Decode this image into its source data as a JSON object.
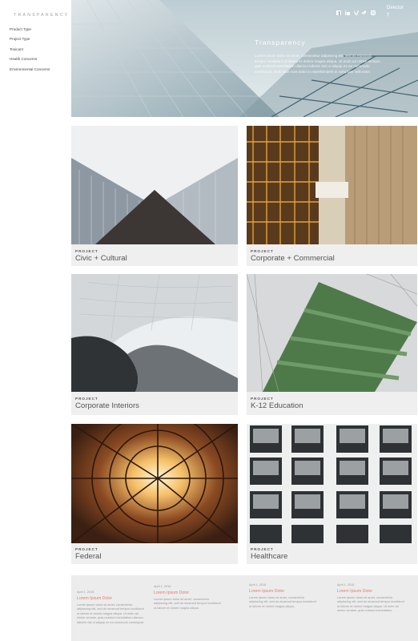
{
  "sidebar": {
    "brand": "TRANSPARENCY",
    "items": [
      "Product Type",
      "Project Type",
      "Toxicant",
      "Health Concerns",
      "Environmental Concerns"
    ]
  },
  "hero": {
    "title": "Transparency",
    "paragraph": "Lorem ipsum dolor sit amet, consectetur adipiscing elit, sed do eiusmod tempor incididunt ut labore et dolore magna aliqua. Ut enim ad minim veniam, quis nostrud exercitation ullamco laboris nisi ut aliquip ex ea commodo consequat. Duis aute irure dolor in reprehenderit in voluptate velit esse.",
    "directory": "Director\ny",
    "social_icons": [
      "facebook-icon",
      "linkedin-icon",
      "vimeo-icon",
      "twitter-icon",
      "instagram-icon"
    ]
  },
  "projects": [
    {
      "kicker": "PROJECT",
      "name": "Civic + Cultural"
    },
    {
      "kicker": "PROJECT",
      "name": "Corporate + Commercial"
    },
    {
      "kicker": "PROJECT",
      "name": "Corporate Interiors"
    },
    {
      "kicker": "PROJECT",
      "name": "K-12 Education"
    },
    {
      "kicker": "PROJECT",
      "name": "Federal"
    },
    {
      "kicker": "PROJECT",
      "name": "Healthcare"
    }
  ],
  "news": [
    {
      "date": "April 1, 2016",
      "title": "Lorem Ipsum Dolor",
      "text": "Lorem ipsum dolor sit amet, consectetur adipiscing elit, sed do eiusmod tempor incididunt ut labore et dolore magna aliqua. Ut enim ad minim veniam, quis nostrud exercitation ullamco laboris nisi ut aliquip ex ea commodo consequat."
    },
    {
      "date": "April 1, 2016",
      "title": "Lorem Ipsum Dolor",
      "text": "Lorem ipsum dolor sit amet, consectetur adipiscing elit, sed do eiusmod tempor incididunt ut labore et dolore magna aliqua."
    },
    {
      "date": "April 1, 2016",
      "title": "Lorem Ipsum Dolor",
      "text": "Lorem ipsum dolor sit amet, consectetur adipiscing elit, sed do eiusmod tempor incididunt ut labore et dolore magna aliqua."
    },
    {
      "date": "April 1, 2016",
      "title": "Lorem Ipsum Dolor",
      "text": "Lorem ipsum dolor sit amet, consectetur adipiscing elit, sed do eiusmod tempor incididunt ut labore et dolore magna aliqua. Ut enim ad minim veniam, quis nostrud exercitation."
    }
  ],
  "colors": {
    "accent": "#e57c6a",
    "card_bg": "#efefef",
    "news_bg": "#ececec"
  }
}
